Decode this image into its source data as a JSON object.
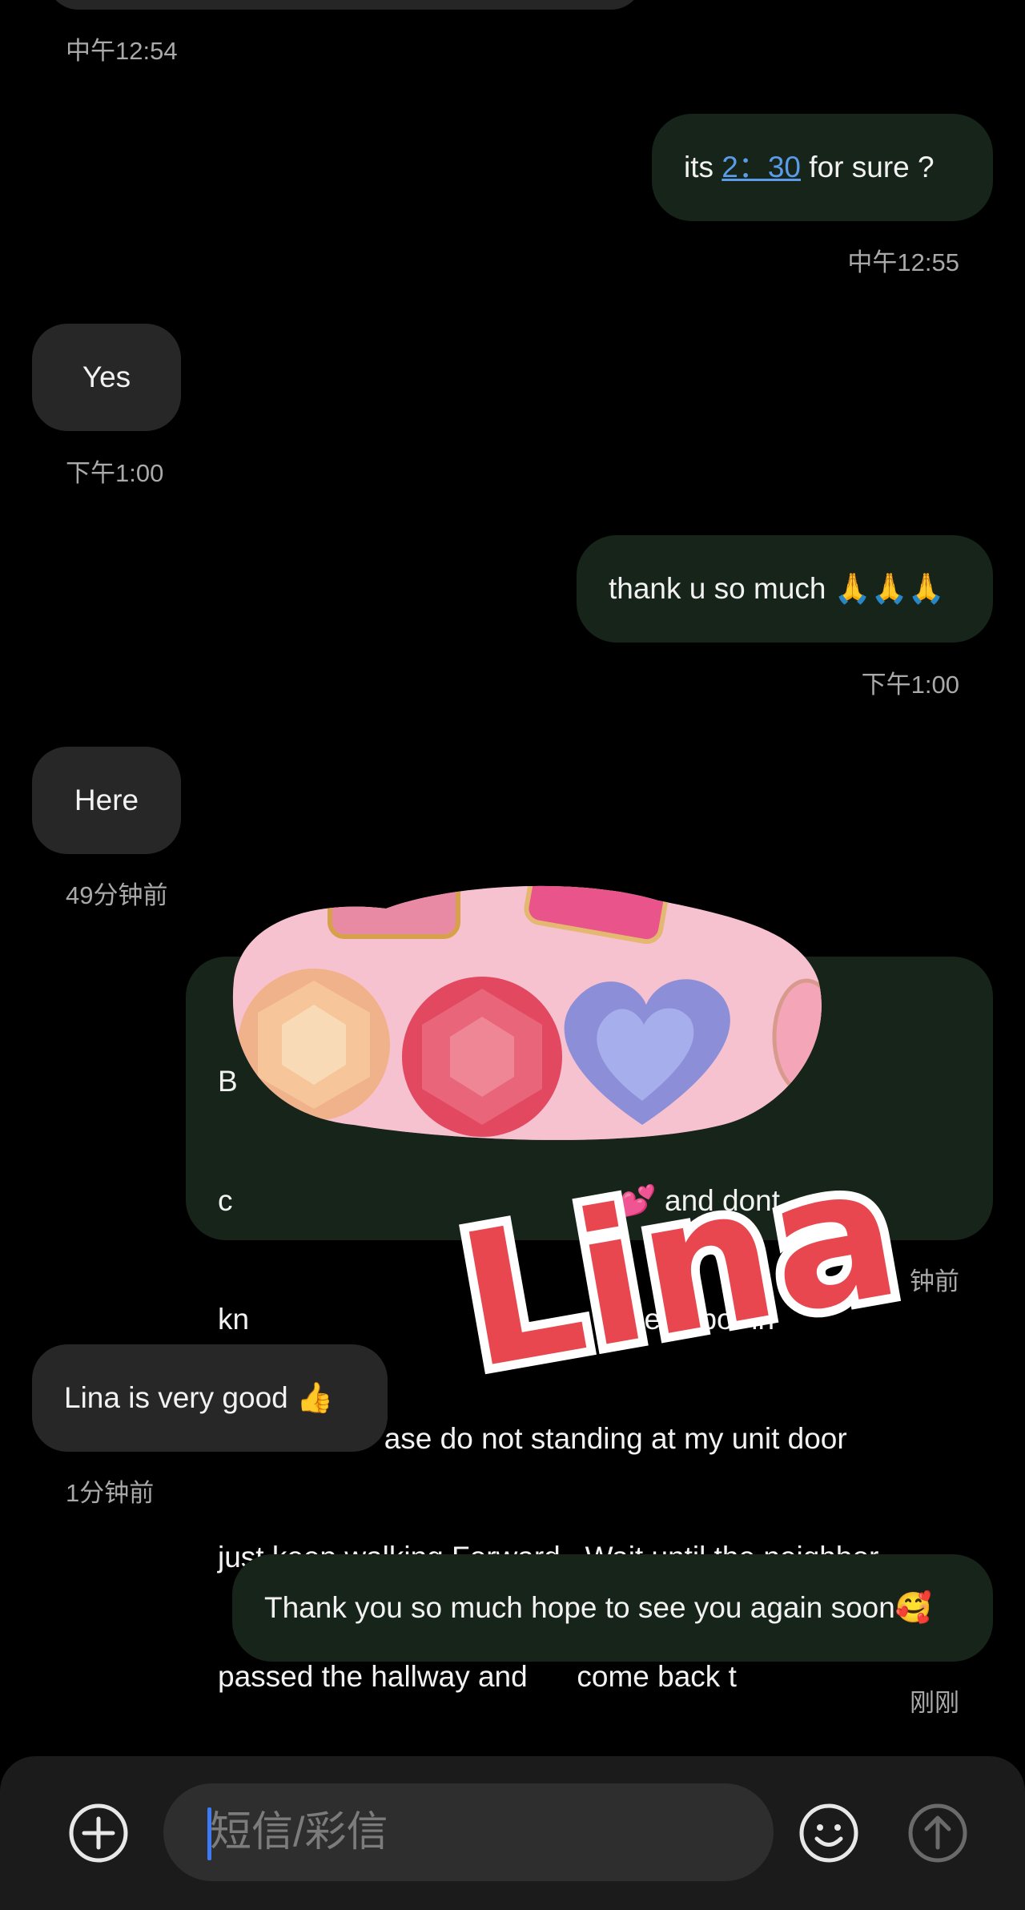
{
  "conversation": {
    "messages": [
      {
        "dir": "in",
        "text_before": "",
        "timestamp": "中午12:54"
      },
      {
        "dir": "out",
        "text_before": "its ",
        "link": "2：30",
        "text_after": " for sure ?",
        "timestamp": "中午12:55"
      },
      {
        "dir": "in",
        "text": "Yes",
        "timestamp": "下午1:00"
      },
      {
        "dir": "out",
        "text": "thank u so much 🙏🙏🙏",
        "timestamp": "下午1:00"
      },
      {
        "dir": "in",
        "text": "Here",
        "timestamp": "49分钟前"
      },
      {
        "dir": "out",
        "lines": [
          "B                                                          ery",
          "c                                               💕 and dont",
          "kn                                              neighbor in",
          "the hallw      ase do not standing at my unit door",
          "just keep walking Forward.  Wait until the neighbor",
          "passed the hallway and      come back t"
        ],
        "timestamp": "钟前"
      },
      {
        "dir": "in",
        "text": "Lina is very good 👍",
        "timestamp": "1分钟前"
      },
      {
        "dir": "out",
        "text": "Thank you so much hope to see you again soon🥰",
        "timestamp": "刚刚"
      }
    ]
  },
  "overlay": {
    "logo_text": "Lina"
  },
  "composer": {
    "placeholder": "短信/彩信",
    "add_icon": "plus-circle-icon",
    "emoji_icon": "smiley-icon",
    "send_icon": "send-arrow-icon"
  },
  "colors": {
    "background": "#000000",
    "incoming_bubble": "#272727",
    "outgoing_bubble": "#16241a",
    "link": "#5b9be8",
    "logo_red": "#e8474f",
    "caret": "#3d7bf5"
  }
}
